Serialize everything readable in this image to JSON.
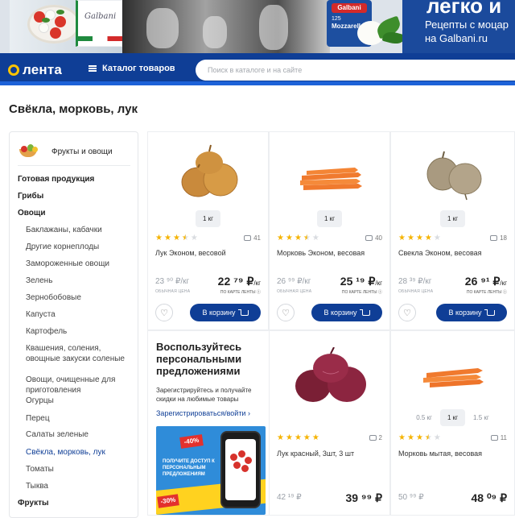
{
  "banner": {
    "headline": "легко и",
    "subline1": "Рецепты с моцар",
    "subline2": "на Galbani.ru",
    "pack_brand": "Galbani",
    "pack_weight": "125",
    "pack_name": "Mozzarella"
  },
  "header": {
    "logo_text": "лента",
    "catalog_label": "Каталог товаров",
    "search_placeholder": "Поиск в каталоге и на сайте"
  },
  "page": {
    "title": "Свёкла, морковь, лук"
  },
  "sidebar": {
    "head_label": "Фрукты и овощи",
    "items": [
      {
        "label": "Готовая продукция",
        "level": "top"
      },
      {
        "label": "Грибы",
        "level": "top"
      },
      {
        "label": "Овощи",
        "level": "top"
      },
      {
        "label": "Баклажаны, кабачки",
        "level": "sub"
      },
      {
        "label": "Другие корнеплоды",
        "level": "sub"
      },
      {
        "label": "Замороженные овощи",
        "level": "sub"
      },
      {
        "label": "Зелень",
        "level": "sub"
      },
      {
        "label": "Зернобобовые",
        "level": "sub"
      },
      {
        "label": "Капуста",
        "level": "sub"
      },
      {
        "label": "Картофель",
        "level": "sub"
      },
      {
        "label": "Квашения, соления, овощные закуски соленые",
        "level": "sub"
      },
      {
        "label": "Овощи, очищенные для приготовления",
        "level": "sub"
      },
      {
        "label": "Огурцы",
        "level": "sub"
      },
      {
        "label": "Перец",
        "level": "sub"
      },
      {
        "label": "Салаты зеленые",
        "level": "sub"
      },
      {
        "label": "Свёкла, морковь, лук",
        "level": "sub",
        "active": true
      },
      {
        "label": "Томаты",
        "level": "sub"
      },
      {
        "label": "Тыква",
        "level": "sub"
      },
      {
        "label": "Фрукты",
        "level": "top"
      }
    ]
  },
  "products": [
    {
      "name": "Лук Эконом, весовой",
      "qty": "1 кг",
      "rating": 3.5,
      "reviews": "41",
      "old_price": "23 ⁹⁰ ₽/кг",
      "old_label": "обычная цена",
      "price": "22 ⁷⁹ ₽",
      "unit": "/кг",
      "price_label": "по карте ленты ⓘ",
      "cart_label": "В корзину"
    },
    {
      "name": "Морковь Эконом, весовая",
      "qty": "1 кг",
      "rating": 3.5,
      "reviews": "40",
      "old_price": "26 ⁹⁹ ₽/кг",
      "old_label": "обычная цена",
      "price": "25 ¹⁹ ₽",
      "unit": "/кг",
      "price_label": "по карте ленты ⓘ",
      "cart_label": "В корзину"
    },
    {
      "name": "Свекла Эконом, весовая",
      "qty": "1 кг",
      "rating": 4,
      "reviews": "18",
      "old_price": "28 ³⁹ ₽/кг",
      "old_label": "обычная цена",
      "price": "26 ⁹¹ ₽",
      "unit": "/кг",
      "price_label": "по карте ленты ⓘ",
      "cart_label": "В корзину"
    },
    {
      "name": "Лук красный, 3шт, 3 шт",
      "rating": 5,
      "reviews": "2",
      "old_price": "42 ¹⁹ ₽",
      "price": "39 ⁹⁹ ₽"
    },
    {
      "name": "Морковь мытая, весовая",
      "qty_prev": "0.5 кг",
      "qty": "1 кг",
      "qty_next": "1.5 кг",
      "rating": 3.5,
      "reviews": "11",
      "old_price": "50 ⁹⁹ ₽",
      "price": "48 ⁰⁹ ₽"
    }
  ],
  "promo": {
    "title": "Воспользуйтесь персональными предложениями",
    "text": "Зарегистрируйтесь и получайте скидки на любимые товары",
    "link": "Зарегистрироваться/войти",
    "tag1": "-40%",
    "tag2": "-30%",
    "image_text": "ПОЛУЧИТЕ ДОСТУП К ПЕРСОНАЛЬНЫМ ПРЕДЛОЖЕНИЯМ"
  },
  "colors": {
    "brand_blue": "#0f3e96",
    "star": "#f5b300",
    "logo_yellow": "#ffc400"
  }
}
